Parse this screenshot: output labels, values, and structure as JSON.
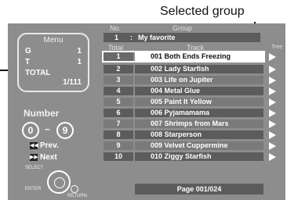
{
  "callout": {
    "selected_group": "Selected group"
  },
  "menu": {
    "title": "Menu",
    "g_key": "G",
    "g_val": "1",
    "t_key": "T",
    "t_val": "1",
    "total_key": "TOTAL",
    "total_val": "1/111"
  },
  "number_panel": {
    "title": "Number",
    "min": "0",
    "dash": "–",
    "max": "9",
    "prev": "Prev.",
    "next": "Next",
    "select_label": "SELECT",
    "enter_label": "ENTER",
    "return_label": "RETURN",
    "prev_icon": "skip-prev-icon",
    "next_icon": "skip-next-icon"
  },
  "header": {
    "no": "No.",
    "group": "Group",
    "selected_group_no": "1",
    "selected_group_sep": ":",
    "selected_group_name": "My favorite",
    "total": "Total",
    "track": "Track",
    "tree": "Tree"
  },
  "tracks": [
    {
      "num": "1",
      "title": "001 Both Ends Freezing"
    },
    {
      "num": "2",
      "title": "002 Lady Starfish"
    },
    {
      "num": "3",
      "title": "003 Life on Jupiter"
    },
    {
      "num": "4",
      "title": "004 Metal Glue"
    },
    {
      "num": "5",
      "title": "005 Paint It Yellow"
    },
    {
      "num": "6",
      "title": "006 Pyjamamama"
    },
    {
      "num": "7",
      "title": "007 Shrimps from Mars"
    },
    {
      "num": "8",
      "title": "008 Starperson"
    },
    {
      "num": "9",
      "title": "009 Velvet Cuppermine"
    },
    {
      "num": "10",
      "title": "010 Ziggy Starfish"
    }
  ],
  "page_indicator": "Page 001/024",
  "colors": {
    "screen_bg": "#8d8d8d",
    "row_dark": "#5c5c5c",
    "row_light": "#7a7a7a",
    "selected": "#ffffff"
  }
}
